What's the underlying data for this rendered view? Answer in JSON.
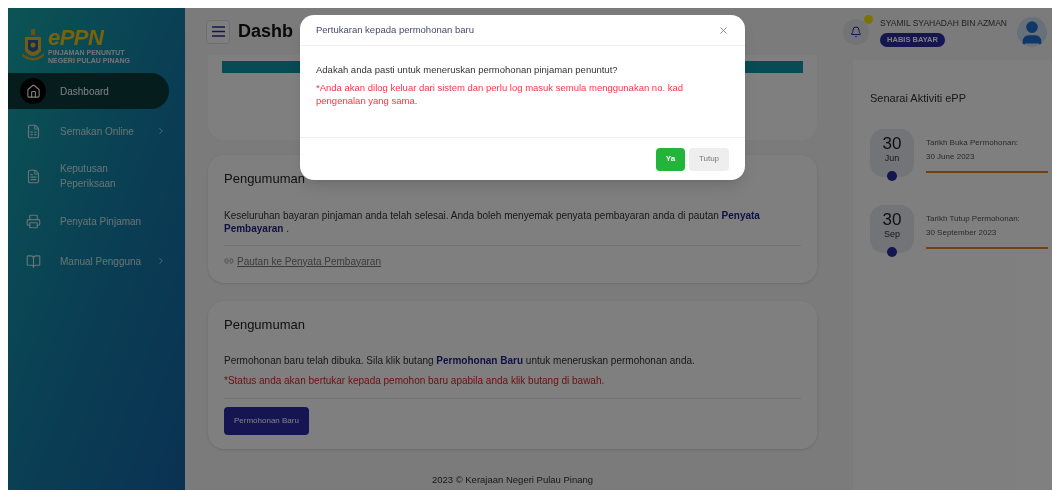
{
  "logo": {
    "wordmark": "ePPN",
    "tagline_lines": [
      "PINJAMAN PENUNTUT",
      "NEGERI PULAU PINANG"
    ]
  },
  "sidebar": {
    "items": [
      {
        "label": "Dashboard",
        "selected": true,
        "has_submenu": false
      },
      {
        "label": "Semakan Online",
        "selected": false,
        "has_submenu": true
      },
      {
        "label": "Keputusan Peperiksaan",
        "selected": false,
        "has_submenu": false
      },
      {
        "label": "Penyata Pinjaman",
        "selected": false,
        "has_submenu": false
      },
      {
        "label": "Manual Pengguna",
        "selected": false,
        "has_submenu": true
      }
    ]
  },
  "header": {
    "title": "Dashb",
    "notification": true,
    "user_name": "SYAMIL SYAHADAH BIN AZMAN",
    "status_badge": "HABIS BAYAR"
  },
  "announcements": [
    {
      "title": "Pengumuman",
      "body": "Keseluruhan bayaran pinjaman anda telah selesai. Anda boleh menyemak penyata pembayaran anda di pautan **Penyata Pembayaran** .",
      "link": "Pautan ke Penyata Pembayaran"
    },
    {
      "title": "Pengumuman",
      "body": "Permohonan baru telah dibuka. Sila klik butang **Permohonan Baru** untuk meneruskan permohonan anda.",
      "note": "*Status anda akan bertukar kepada pemohon baru apabila anda klik butang di bawah.",
      "button": "Permohonan Baru"
    }
  ],
  "activities": {
    "title": "Senarai Aktiviti ePP",
    "items": [
      {
        "day": "30",
        "month": "Jun",
        "label": "Tarikh Buka Permohonan:",
        "date": "30 June 2023"
      },
      {
        "day": "30",
        "month": "Sep",
        "label": "Tarikh Tutup Permohonan:",
        "date": "30 September 2023"
      }
    ]
  },
  "footer": "2023 © Kerajaan Negeri Pulau Pinang",
  "dialog": {
    "title": "Pertukaran kepada permohonan baru",
    "question": "Adakah anda pasti untuk meneruskan permohonan pinjaman penuntut?",
    "warning": "*Anda akan dilog keluar dari sistem dan perlu log masuk semula menggunakan no. kad pengenalan yang sama.",
    "buttons": [
      {
        "label": "Ya",
        "kind": "primary"
      },
      {
        "label": "Tutup",
        "kind": "secondary"
      }
    ]
  }
}
